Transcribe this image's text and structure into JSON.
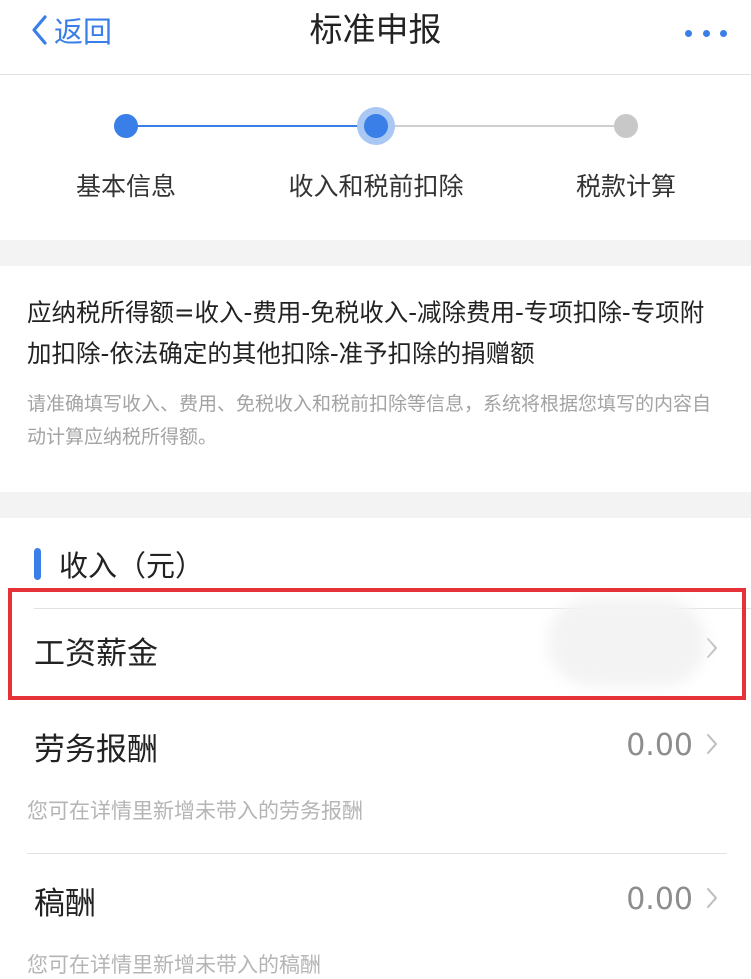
{
  "nav": {
    "back_label": "返回",
    "title": "标准申报",
    "back_icon": "chevron-left-icon",
    "more_icon": "more-horizontal-icon"
  },
  "steps": {
    "items": [
      {
        "label": "基本信息",
        "state": "done"
      },
      {
        "label": "收入和税前扣除",
        "state": "current"
      },
      {
        "label": "税款计算",
        "state": "todo"
      }
    ]
  },
  "formula": {
    "text": "应纳税所得额=收入-费用-免税收入-减除费用-专项扣除-专项附加扣除-依法确定的其他扣除-准予扣除的捐赠额",
    "note": "请准确填写收入、费用、免税收入和税前扣除等信息，系统将根据您填写的内容自动计算应纳税所得额。"
  },
  "income": {
    "title": "收入（元）",
    "rows": [
      {
        "label": "工资薪金",
        "value": "",
        "highlighted": true
      },
      {
        "label": "劳务报酬",
        "value": "0.00",
        "hint": "您可在详情里新增未带入的劳务报酬"
      },
      {
        "label": "稿酬",
        "value": "0.00",
        "hint": "您可在详情里新增未带入的稿酬"
      }
    ]
  },
  "colors": {
    "accent": "#3a7ee8",
    "highlight_border": "#e53238",
    "muted_text": "#a3a3a3",
    "gap_bg": "#f3f3f3"
  }
}
